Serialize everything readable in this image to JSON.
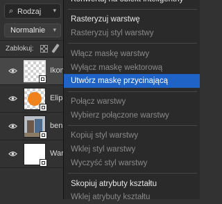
{
  "layers_panel": {
    "filter": {
      "value": "Rodzaj"
    },
    "blend_mode": {
      "value": "Normalnie"
    },
    "lock": {
      "label": "Zablokuj:"
    },
    "layers": [
      {
        "name": "Ikon",
        "selected": true
      },
      {
        "name": "Elip"
      },
      {
        "name": "ben"
      },
      {
        "name": "War"
      }
    ]
  },
  "context_menu": {
    "items": [
      {
        "label": "Konwertuj na obiekt inteligentny",
        "state": "enabled"
      },
      {
        "label": "Rasteryzuj warstwę",
        "state": "enabled"
      },
      {
        "label": "Rasteryzuj styl warstwy",
        "state": "disabled"
      },
      {
        "label": "Włącz maskę warstwy",
        "state": "disabled"
      },
      {
        "label": "Wyłącz maskę wektorową",
        "state": "disabled"
      },
      {
        "label": "Utwórz maskę przycinającą",
        "state": "highlighted"
      },
      {
        "label": "Połącz warstwy",
        "state": "disabled"
      },
      {
        "label": "Wybierz połączone warstwy",
        "state": "disabled"
      },
      {
        "label": "Kopiuj styl warstwy",
        "state": "disabled"
      },
      {
        "label": "Wklej styl warstwy",
        "state": "disabled"
      },
      {
        "label": "Wyczyść styl warstwy",
        "state": "disabled"
      },
      {
        "label": "Skopiuj atrybuty kształtu",
        "state": "enabled"
      },
      {
        "label": "Wklej atrybuty kształtu",
        "state": "disabled"
      }
    ]
  },
  "colors": {
    "highlight": "#1f63c7",
    "ellipse_orange": "#f0821e"
  }
}
